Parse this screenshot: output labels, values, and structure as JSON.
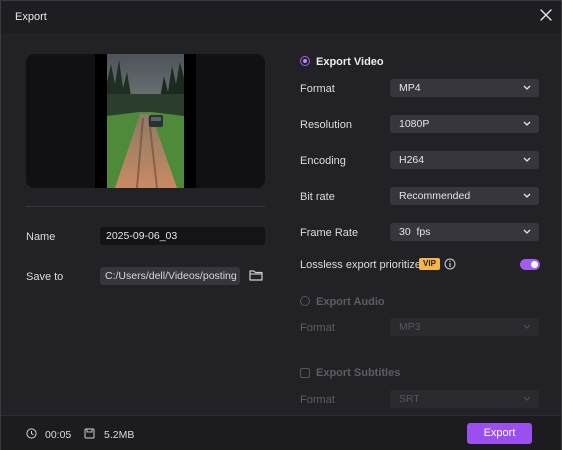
{
  "window": {
    "title": "Export",
    "close_icon": "close-icon"
  },
  "left": {
    "name_label": "Name",
    "name_value": "2025-09-06_03",
    "save_label": "Save to",
    "save_path": "C:/Users/dell/Videos/posting",
    "folder_icon": "folder-icon"
  },
  "video": {
    "header": "Export Video",
    "selected": true,
    "fields": [
      {
        "label": "Format",
        "value": "MP4"
      },
      {
        "label": "Resolution",
        "value": "1080P"
      },
      {
        "label": "Encoding",
        "value": "H264"
      },
      {
        "label": "Bit rate",
        "value": "Recommended"
      },
      {
        "label": "Frame Rate",
        "value": "30  fps"
      }
    ],
    "lossless_label": "Lossless export prioritized",
    "vip_badge": "VIP",
    "lossless_enabled": true
  },
  "audio": {
    "header": "Export Audio",
    "selected": false,
    "format_label": "Format",
    "format_value": "MP3"
  },
  "subtitles": {
    "header": "Export Subtitles",
    "checked": false,
    "format_label": "Format",
    "format_value": "SRT"
  },
  "footer": {
    "duration": "00:05",
    "size": "5.2MB",
    "export_label": "Export"
  },
  "colors": {
    "accent": "#9b4ff0",
    "vip": "#f5b54a",
    "background": "#222226"
  }
}
